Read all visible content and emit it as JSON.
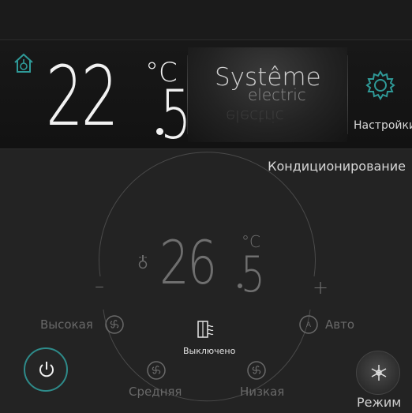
{
  "header": {
    "temperature_integer": "22",
    "temperature_decimal": "5",
    "temperature_unit": "°C",
    "brand_line1": "Systême",
    "brand_line2": "electric",
    "settings_label": "Настройки"
  },
  "mode": {
    "title": "Кондиционирование"
  },
  "control": {
    "setpoint_integer": "26",
    "setpoint_decimal": "5",
    "setpoint_unit": "°C",
    "minus": "–",
    "plus": "+",
    "status": "Выключено"
  },
  "fan_speeds": {
    "high": "Высокая",
    "medium": "Средняя",
    "low": "Низкая",
    "auto": "Авто"
  },
  "bottom": {
    "mode_label": "Режим"
  },
  "colors": {
    "accent_teal": "#2e8b8a",
    "text_light": "#f2f2f2",
    "text_dim": "#6f6f6f"
  },
  "icons": {
    "home": "home-thermometer-icon",
    "settings": "gear-icon",
    "fan": "fan-icon",
    "status": "window-airflow-icon",
    "power": "power-icon",
    "mode": "snowflake-icon"
  }
}
